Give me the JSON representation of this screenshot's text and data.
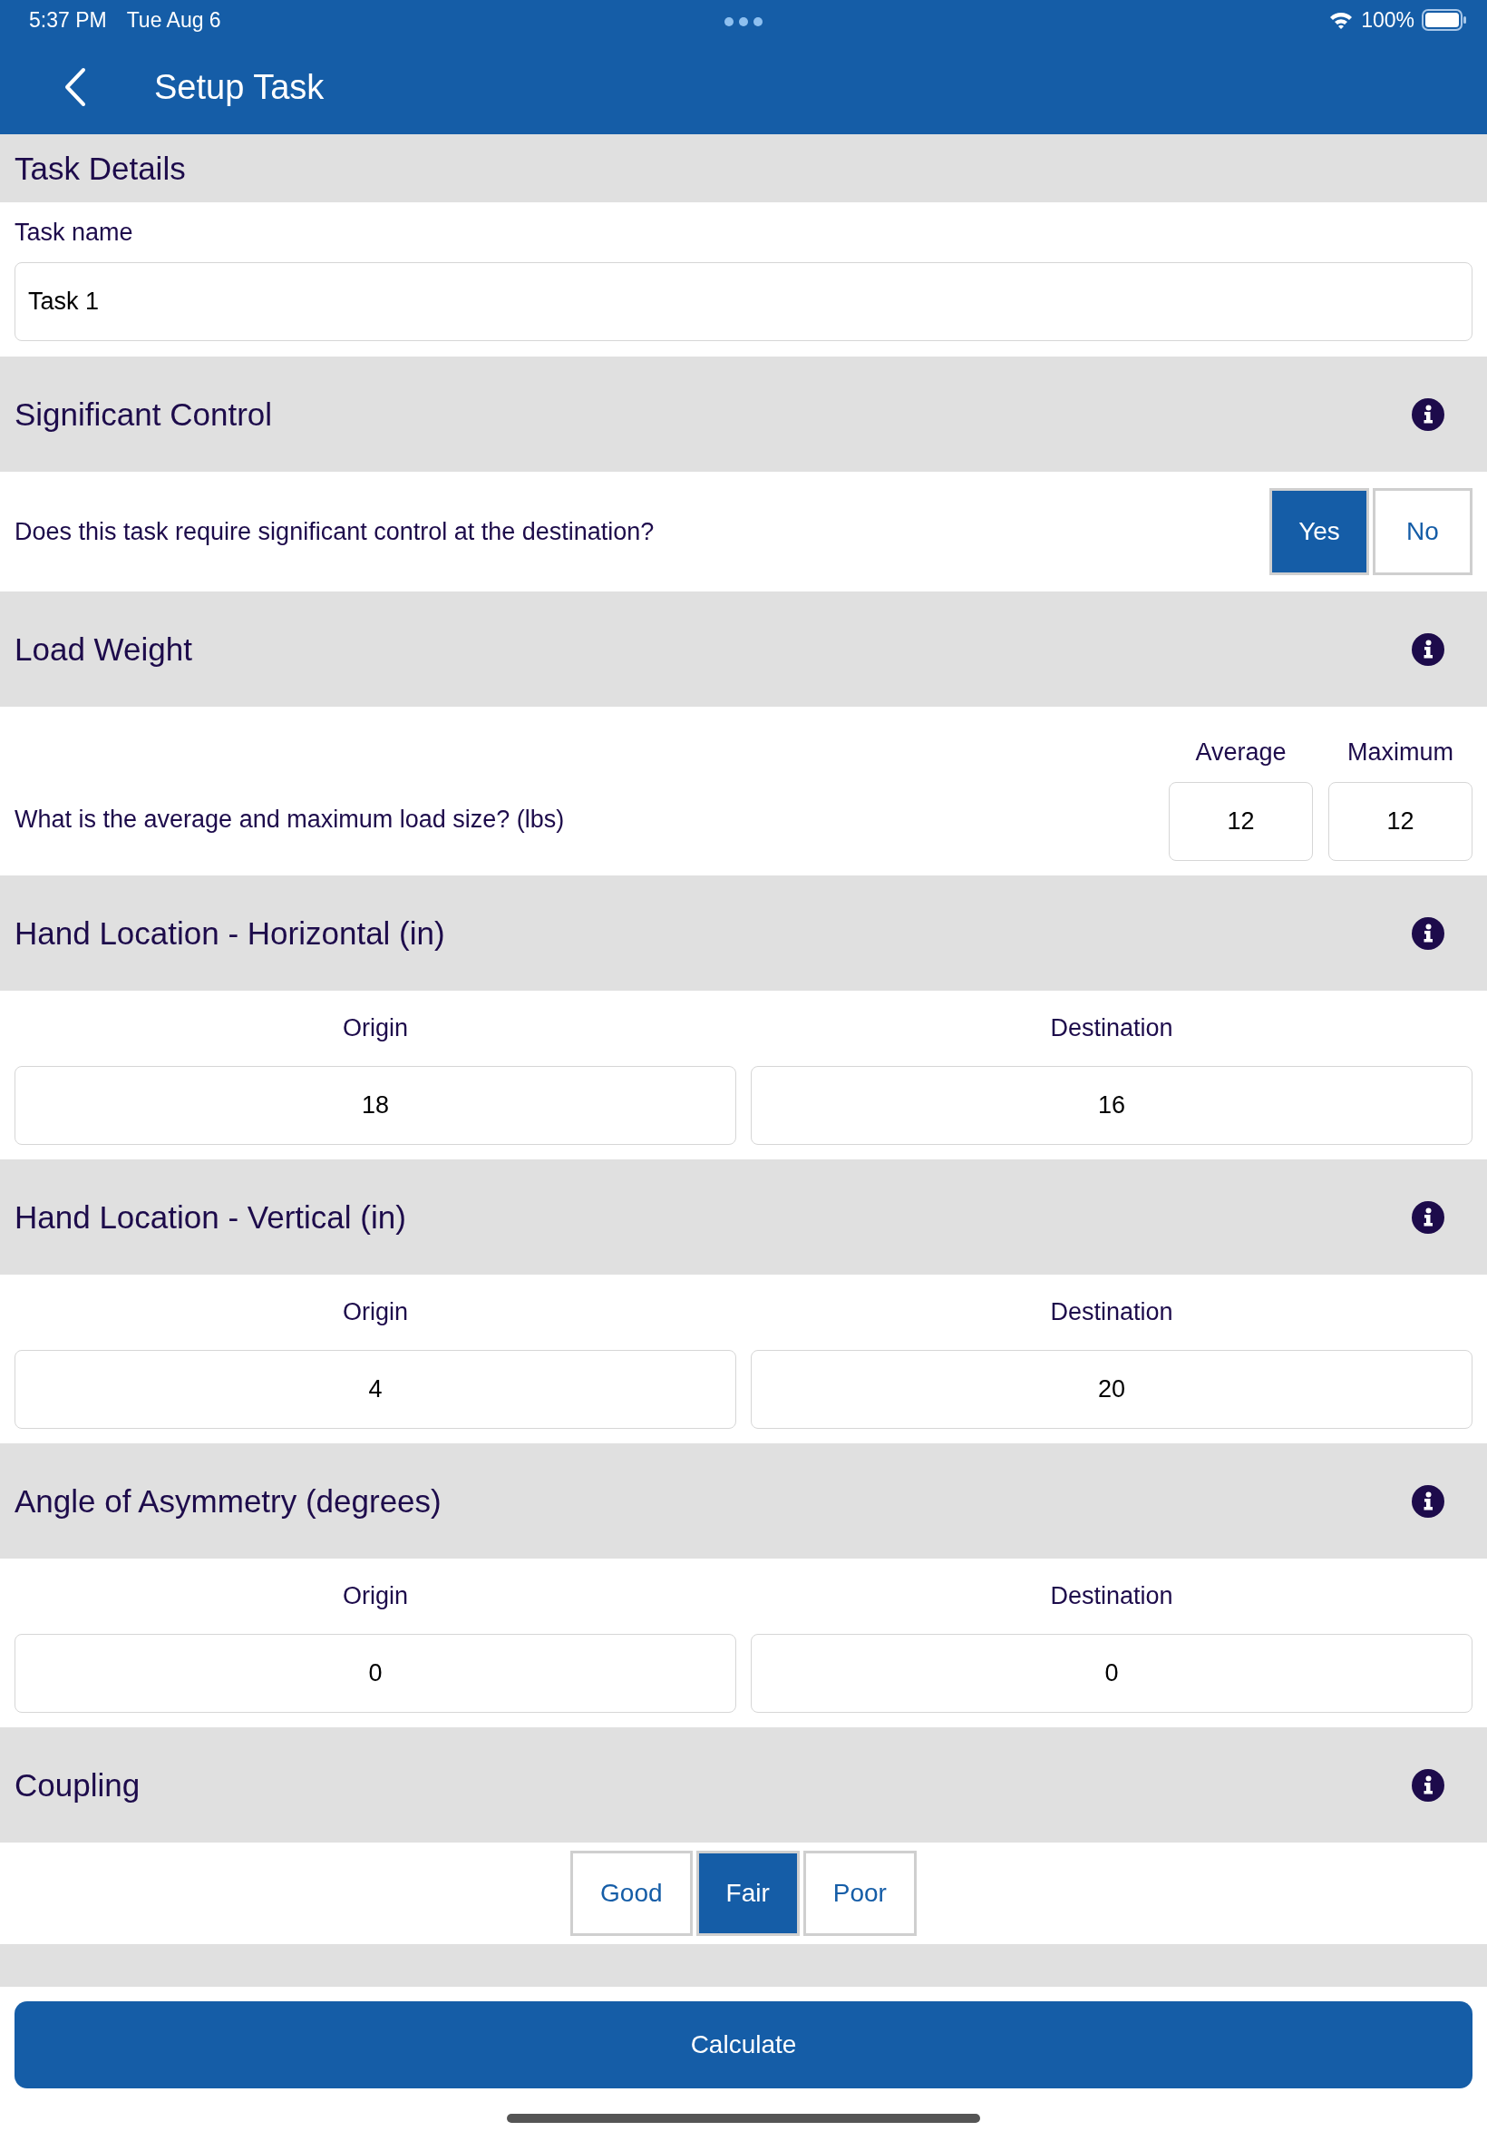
{
  "status_bar": {
    "time": "5:37 PM",
    "date": "Tue Aug 6",
    "battery": "100%"
  },
  "nav": {
    "title": "Setup Task"
  },
  "sections": [
    {
      "kind": "text",
      "title": "Task Details",
      "info": false,
      "label": "Task name",
      "value": "Task 1"
    },
    {
      "kind": "choice",
      "title": "Significant Control",
      "info": true,
      "question": "Does this task require significant control at the destination?",
      "options": [
        {
          "label": "Yes",
          "selected": true
        },
        {
          "label": "No",
          "selected": false
        }
      ]
    },
    {
      "kind": "inline-pair",
      "title": "Load Weight",
      "info": true,
      "question": "What is the average and maximum load size? (lbs)",
      "fields": [
        {
          "label": "Average",
          "value": "12"
        },
        {
          "label": "Maximum",
          "value": "12"
        }
      ]
    },
    {
      "kind": "pair",
      "title": "Hand Location - Horizontal (in)",
      "info": true,
      "fields": [
        {
          "label": "Origin",
          "value": "18"
        },
        {
          "label": "Destination",
          "value": "16"
        }
      ]
    },
    {
      "kind": "pair",
      "title": "Hand Location - Vertical (in)",
      "info": true,
      "fields": [
        {
          "label": "Origin",
          "value": "4"
        },
        {
          "label": "Destination",
          "value": "20"
        }
      ]
    },
    {
      "kind": "pair",
      "title": "Angle of Asymmetry (degrees)",
      "info": true,
      "fields": [
        {
          "label": "Origin",
          "value": "0"
        },
        {
          "label": "Destination",
          "value": "0"
        }
      ]
    },
    {
      "kind": "segmented",
      "title": "Coupling",
      "info": true,
      "options": [
        {
          "label": "Good",
          "selected": false
        },
        {
          "label": "Fair",
          "selected": true
        },
        {
          "label": "Poor",
          "selected": false
        }
      ]
    }
  ],
  "calculate_button": "Calculate"
}
